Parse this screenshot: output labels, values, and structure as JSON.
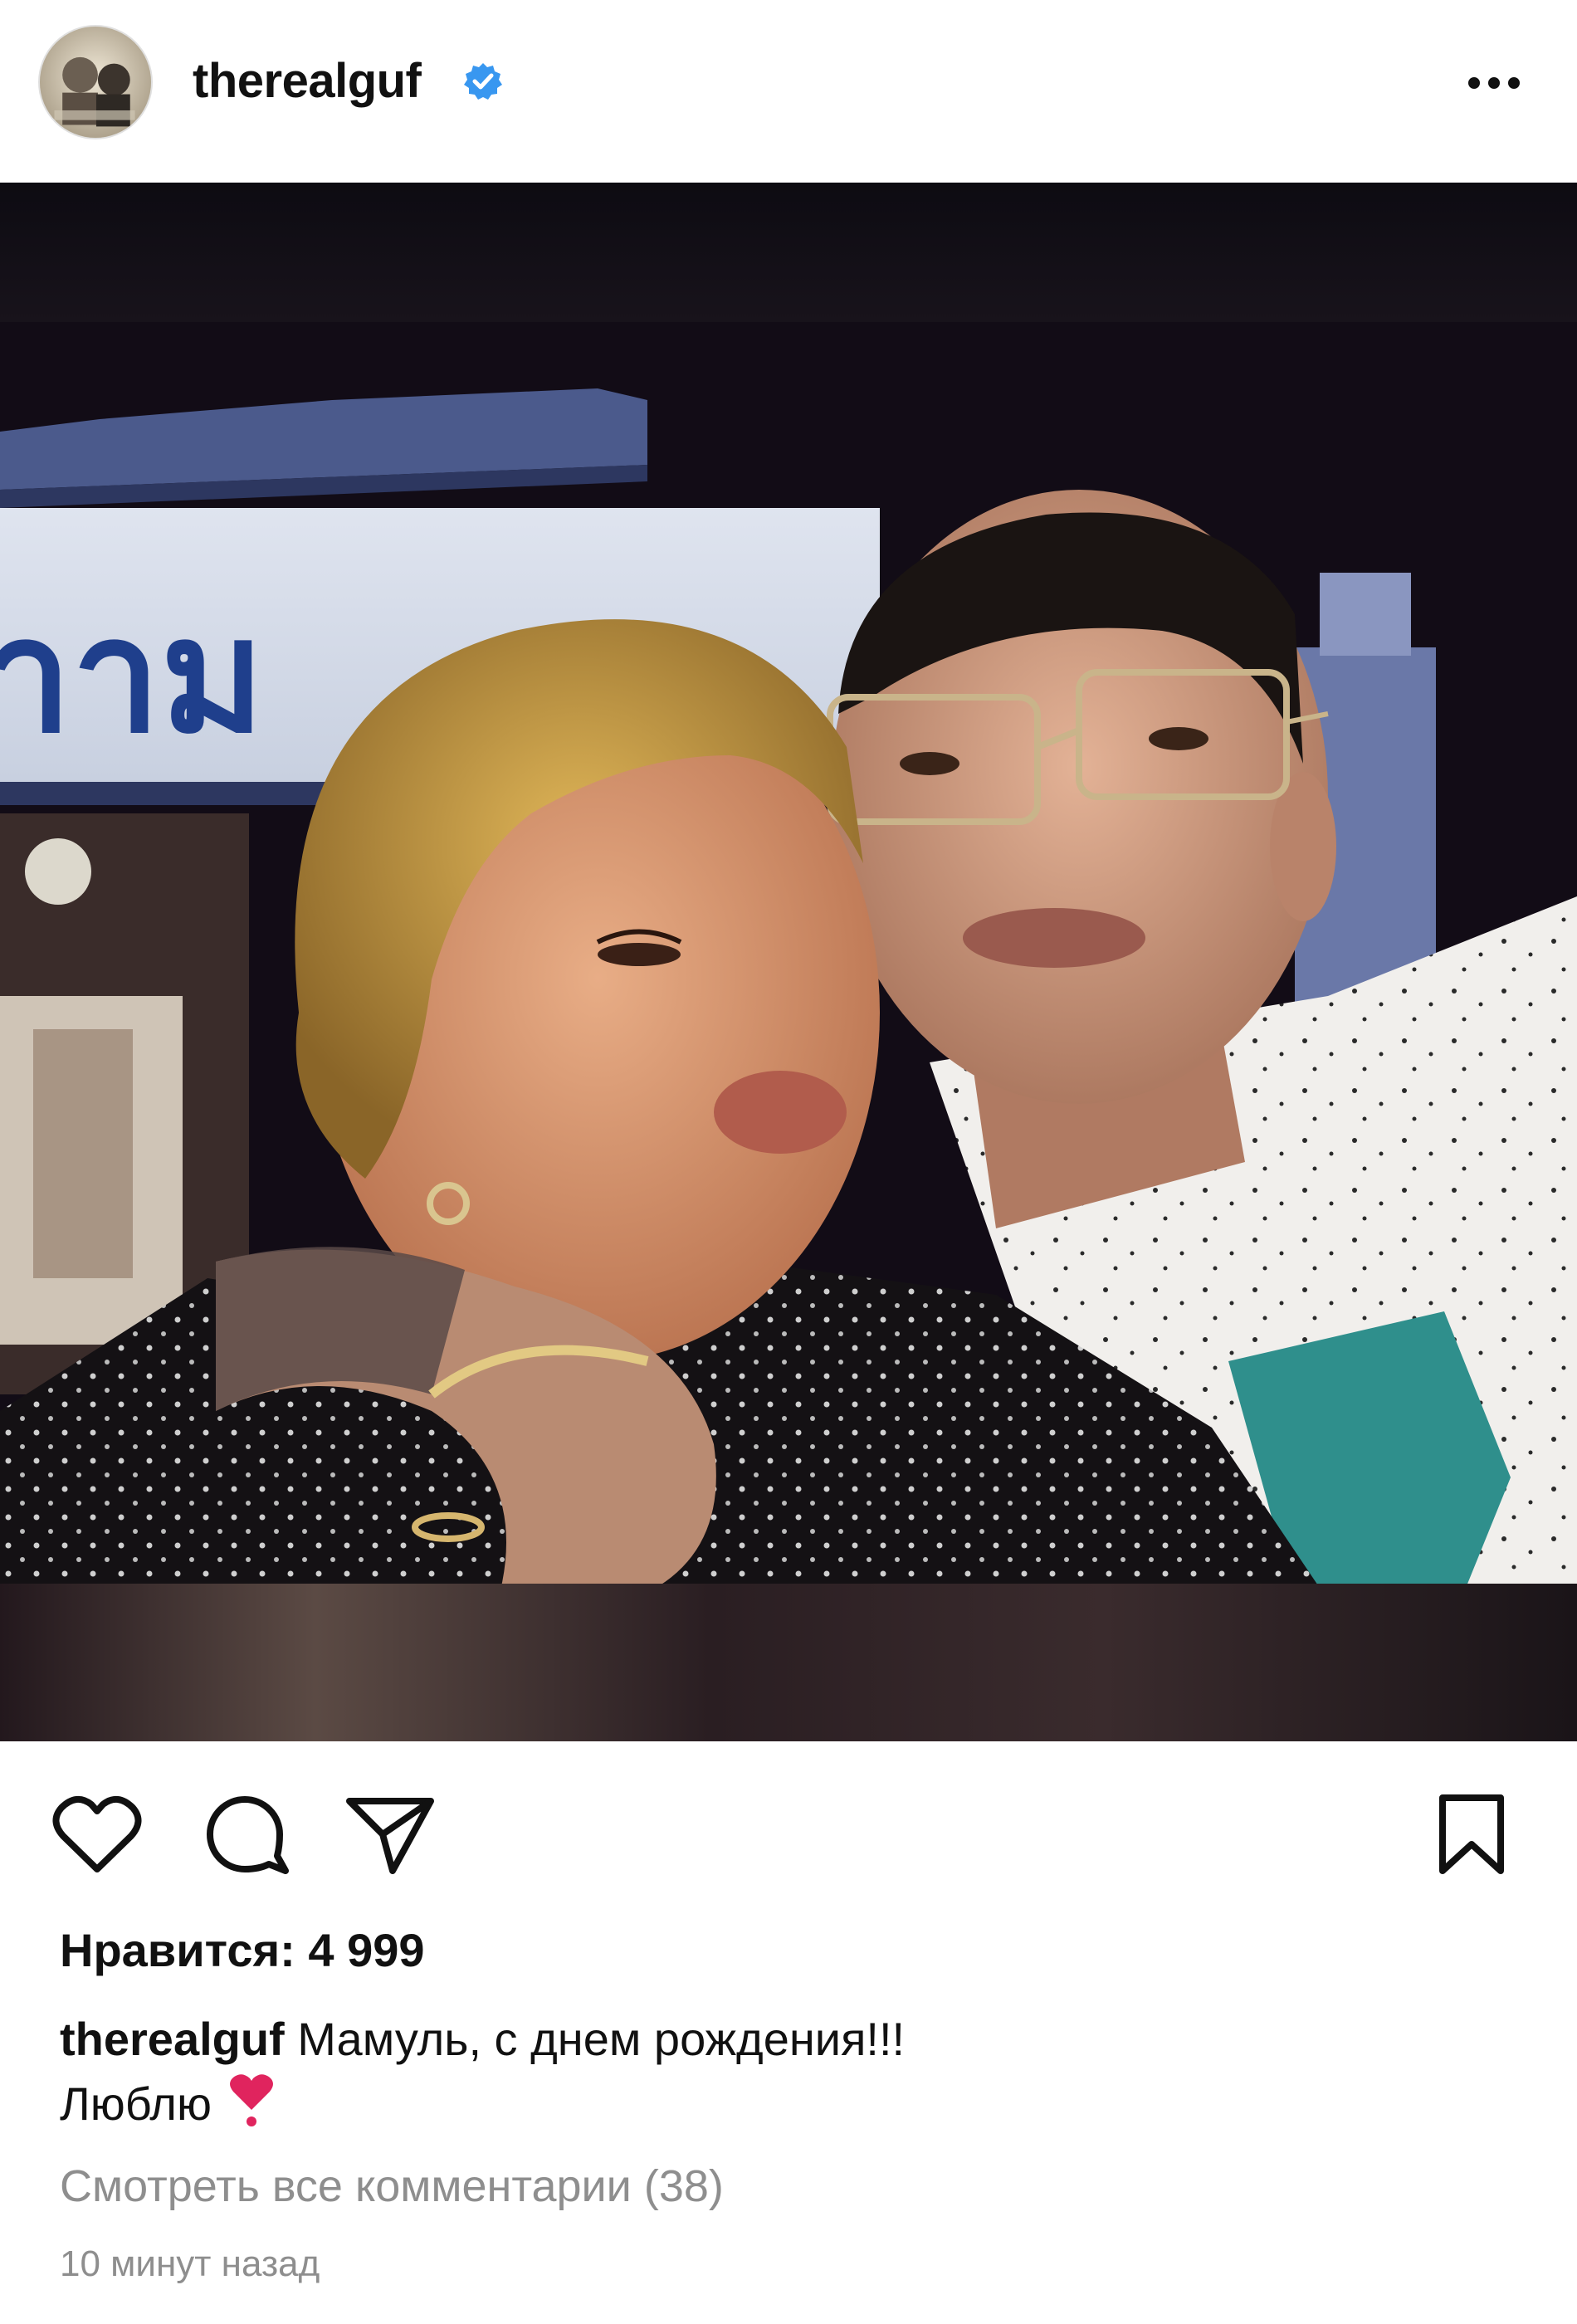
{
  "header": {
    "username": "therealguf",
    "verified": true,
    "verified_color": "#3897f0",
    "avatar_icon": "user-avatar",
    "more_icon": "more-horizontal-icon"
  },
  "post": {
    "image_icon": "post-photo"
  },
  "actions": {
    "like_icon": "heart-icon",
    "comment_icon": "comment-icon",
    "share_icon": "share-icon",
    "save_icon": "bookmark-icon"
  },
  "likes": {
    "text": "Нравится: 4 999"
  },
  "caption": {
    "username": "therealguf",
    "text": "Мамуль, с днем рождения!!!",
    "text_line2": "Люблю",
    "emoji_icon": "red-heart-exclamation-icon",
    "emoji_color": "#e0245e"
  },
  "comments": {
    "view_all": "Смотреть все комментарии (38)"
  },
  "timestamp": {
    "text": "10 минут назад"
  }
}
